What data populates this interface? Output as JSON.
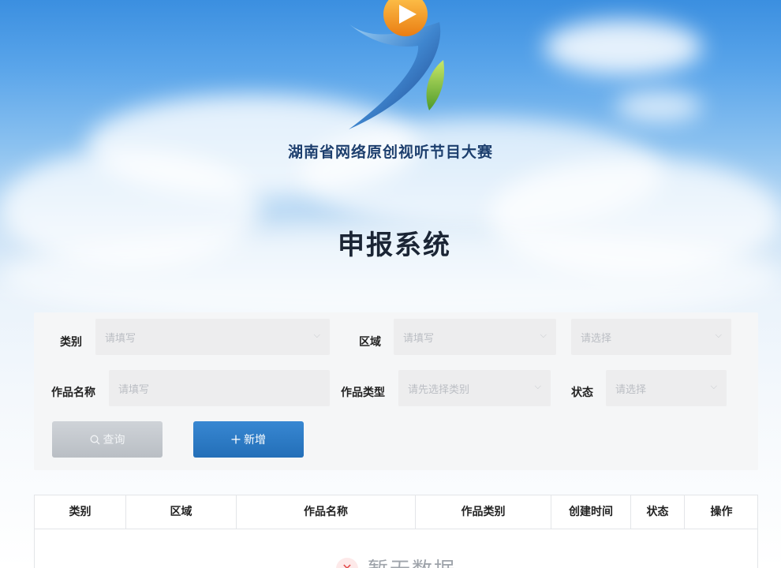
{
  "header": {
    "brand_name": "湖南省网络原创视听节目大赛",
    "page_title": "申报系统"
  },
  "filters": {
    "category": {
      "label": "类别",
      "placeholder": "请填写"
    },
    "region": {
      "label": "区域",
      "placeholder": "请填写"
    },
    "extra_select": {
      "placeholder": "请选择"
    },
    "work_name": {
      "label": "作品名称",
      "placeholder": "请填写"
    },
    "work_type": {
      "label": "作品类型",
      "placeholder": "请先选择类别"
    },
    "status": {
      "label": "状态",
      "placeholder": "请选择"
    }
  },
  "actions": {
    "query_label": "查询",
    "add_label": "新增"
  },
  "table": {
    "columns": [
      "类别",
      "区域",
      "作品名称",
      "作品类别",
      "创建时间",
      "状态",
      "操作"
    ],
    "empty_text": "暂无数据"
  },
  "icons": {
    "play": "play-icon",
    "search": "search-icon",
    "plus": "plus-icon",
    "chevron": "chevron-down-icon",
    "error": "close-circle-icon"
  },
  "colors": {
    "primary": "#236fb8",
    "brand_text": "#1d3f6e",
    "logo_orange": "#f29a1c",
    "logo_green": "#7dbb34"
  }
}
